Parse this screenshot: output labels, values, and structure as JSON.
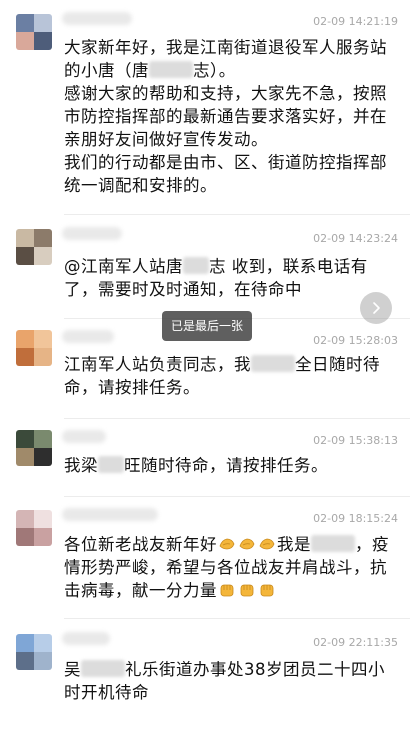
{
  "toast": {
    "text": "已是最后一张"
  },
  "messages": [
    {
      "time": "02-09 14:21:19",
      "lines": [
        "大家新年好，我是江南街道退役军人服务站的小唐（唐",
        "志）。",
        "感谢大家的帮助和支持，大家先不急，按照市防控指挥部的最新通告要求落实好，并在亲朋好友间做好宣传发动。",
        "我们的行动都是由市、区、街道防控指挥部统一调配和安排的。"
      ]
    },
    {
      "time": "02-09 14:23:24",
      "before": "@江南军人站唐",
      "after": "志 收到，联系电话有了，需要时及时通知，在待命中"
    },
    {
      "time": "02-09 15:28:03",
      "before": "江南军人站负责同志，我",
      "after": "全日随时待命，请按排任务。"
    },
    {
      "time": "02-09 15:38:13",
      "before": "我梁",
      "after": "旺随时待命，请按排任务。"
    },
    {
      "time": "02-09 18:15:24",
      "before": "各位新老战友新年好",
      "middle": "我是",
      "after": "，疫情形势严峻，希望与各位战友并肩战斗，抗击病毒，献一分力量"
    },
    {
      "time": "02-09 22:11:35",
      "before": "吴",
      "after": "礼乐街道办事处38岁团员二十四小时开机待命"
    }
  ],
  "icons": {
    "clap": "clapping-hands-icon",
    "fist": "raised-fist-icon",
    "next": "chevron-right-icon"
  },
  "colors": {
    "text": "#111111",
    "time": "#a8a8a8",
    "emoji": "#f4b63a"
  }
}
